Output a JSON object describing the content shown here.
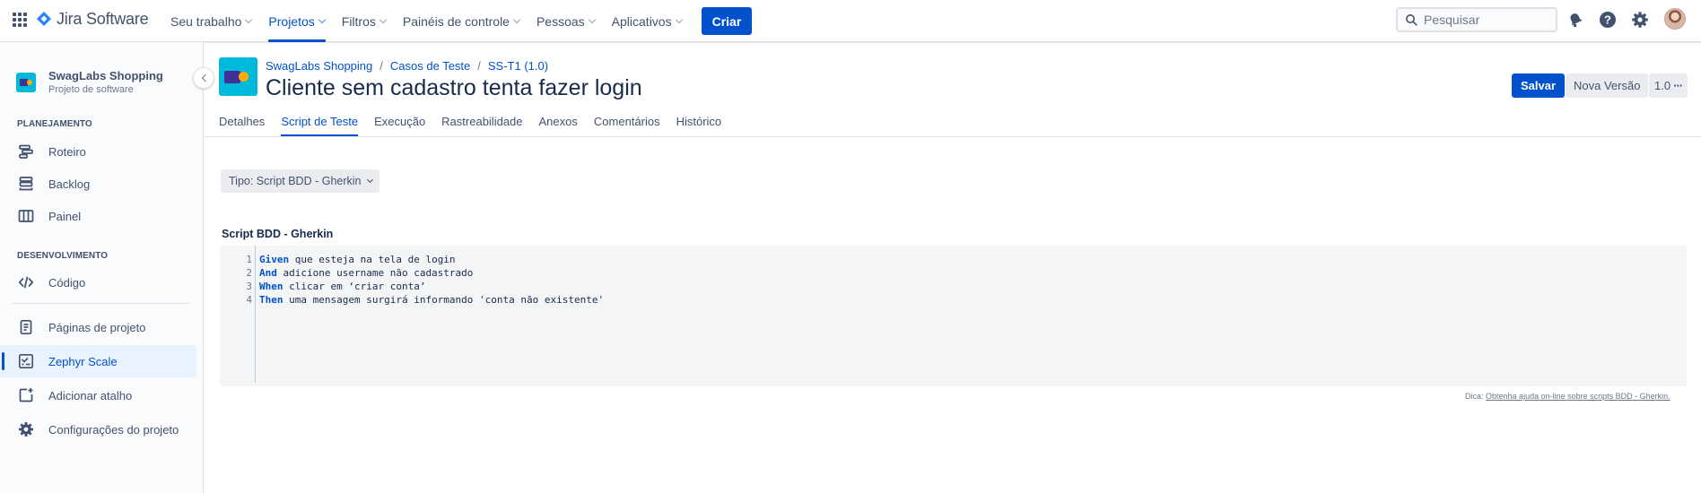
{
  "topnav": {
    "logo_text": "Jira Software",
    "items": [
      {
        "label": "Seu trabalho"
      },
      {
        "label": "Projetos"
      },
      {
        "label": "Filtros"
      },
      {
        "label": "Painéis de controle"
      },
      {
        "label": "Pessoas"
      },
      {
        "label": "Aplicativos"
      }
    ],
    "active_item": "Projetos",
    "create_label": "Criar",
    "search_placeholder": "Pesquisar"
  },
  "sidebar": {
    "project_name": "SwagLabs Shopping",
    "project_type": "Projeto de software",
    "sections": {
      "planning": "PLANEJAMENTO",
      "development": "DESENVOLVIMENTO"
    },
    "items": [
      {
        "label": "Roteiro",
        "icon": "roadmap-icon"
      },
      {
        "label": "Backlog",
        "icon": "backlog-icon"
      },
      {
        "label": "Painel",
        "icon": "board-icon"
      },
      {
        "label": "Código",
        "icon": "code-icon"
      },
      {
        "label": "Páginas de projeto",
        "icon": "pages-icon"
      },
      {
        "label": "Zephyr Scale",
        "icon": "zephyr-icon"
      },
      {
        "label": "Adicionar atalho",
        "icon": "add-shortcut-icon"
      },
      {
        "label": "Configurações do projeto",
        "icon": "gear-icon"
      }
    ],
    "selected_item": "Zephyr Scale"
  },
  "issue": {
    "breadcrumb": [
      "SwagLabs Shopping",
      "Casos de Teste",
      "SS-T1 (1.0)"
    ],
    "title": "Cliente sem cadastro tenta fazer login",
    "save_label": "Salvar",
    "new_version_label": "Nova Versão",
    "version": "1.0"
  },
  "tabs": [
    {
      "label": "Detalhes"
    },
    {
      "label": "Script de Teste"
    },
    {
      "label": "Execução"
    },
    {
      "label": "Rastreabilidade"
    },
    {
      "label": "Anexos"
    },
    {
      "label": "Comentários"
    },
    {
      "label": "Histórico"
    }
  ],
  "active_tab": "Script de Teste",
  "script": {
    "type_label": "Tipo: Script BDD - Gherkin",
    "section_label": "Script BDD - Gherkin",
    "lines": [
      {
        "n": "1",
        "keyword": "Given",
        "text": " que esteja na tela de login"
      },
      {
        "n": "2",
        "keyword": "And",
        "text": " adicione username não cadastrado"
      },
      {
        "n": "3",
        "keyword": "When",
        "text": " clicar em ‘criar conta’"
      },
      {
        "n": "4",
        "keyword": "Then",
        "text": " uma mensagem surgirá informando 'conta não existente'"
      }
    ],
    "hint_prefix": "Dica:",
    "hint_link": "Obtenha ajuda on-line sobre scripts BDD - Gherkin."
  },
  "colors": {
    "primary": "#0052cc",
    "text": "#172b4d",
    "subtle": "#42526e"
  }
}
